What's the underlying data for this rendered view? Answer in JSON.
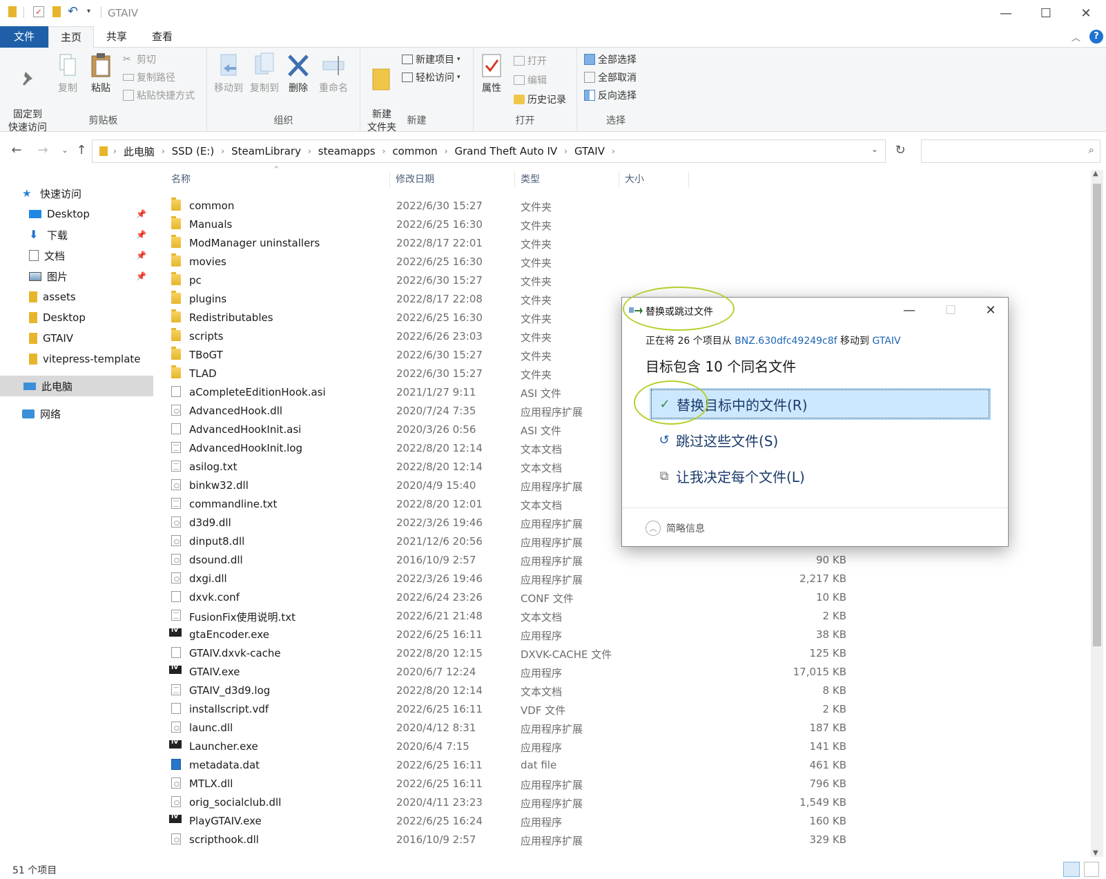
{
  "window": {
    "title": "GTAIV"
  },
  "ribbon_tabs": [
    "文件",
    "主页",
    "共享",
    "查看"
  ],
  "ribbon": {
    "clipboard": {
      "label": "剪贴板",
      "pin": "固定到\n快速访问",
      "copy": "复制",
      "paste": "粘贴",
      "cut": "剪切",
      "copy_path": "复制路径",
      "paste_shortcut": "粘贴快捷方式"
    },
    "organize": {
      "label": "组织",
      "move_to": "移动到",
      "copy_to": "复制到",
      "delete": "删除",
      "rename": "重命名"
    },
    "new": {
      "label": "新建",
      "new_folder": "新建\n文件夹",
      "new_item": "新建项目",
      "easy_access": "轻松访问"
    },
    "open": {
      "label": "打开",
      "properties": "属性",
      "open": "打开",
      "edit": "编辑",
      "history": "历史记录"
    },
    "select": {
      "label": "选择",
      "select_all": "全部选择",
      "select_none": "全部取消",
      "invert": "反向选择"
    }
  },
  "breadcrumb": [
    "此电脑",
    "SSD (E:)",
    "SteamLibrary",
    "steamapps",
    "common",
    "Grand Theft Auto IV",
    "GTAIV"
  ],
  "nav_pane": {
    "quick_access": "快速访问",
    "pinned": [
      "Desktop",
      "下载",
      "文档",
      "图片"
    ],
    "recent": [
      "assets",
      "Desktop",
      "GTAIV",
      "vitepress-template"
    ],
    "this_pc": "此电脑",
    "network": "网络"
  },
  "columns": {
    "name": "名称",
    "date": "修改日期",
    "type": "类型",
    "size": "大小"
  },
  "files": [
    {
      "name": "common",
      "date": "2022/6/30 15:27",
      "type": "文件夹",
      "size": "",
      "icon": "folder"
    },
    {
      "name": "Manuals",
      "date": "2022/6/25 16:30",
      "type": "文件夹",
      "size": "",
      "icon": "folder"
    },
    {
      "name": "ModManager uninstallers",
      "date": "2022/8/17 22:01",
      "type": "文件夹",
      "size": "",
      "icon": "folder"
    },
    {
      "name": "movies",
      "date": "2022/6/25 16:30",
      "type": "文件夹",
      "size": "",
      "icon": "folder"
    },
    {
      "name": "pc",
      "date": "2022/6/30 15:27",
      "type": "文件夹",
      "size": "",
      "icon": "folder"
    },
    {
      "name": "plugins",
      "date": "2022/8/17 22:08",
      "type": "文件夹",
      "size": "",
      "icon": "folder"
    },
    {
      "name": "Redistributables",
      "date": "2022/6/25 16:30",
      "type": "文件夹",
      "size": "",
      "icon": "folder"
    },
    {
      "name": "scripts",
      "date": "2022/6/26 23:03",
      "type": "文件夹",
      "size": "",
      "icon": "folder"
    },
    {
      "name": "TBoGT",
      "date": "2022/6/30 15:27",
      "type": "文件夹",
      "size": "",
      "icon": "folder"
    },
    {
      "name": "TLAD",
      "date": "2022/6/30 15:27",
      "type": "文件夹",
      "size": "",
      "icon": "folder"
    },
    {
      "name": "aCompleteEditionHook.asi",
      "date": "2021/1/27 9:11",
      "type": "ASI 文件",
      "size": "",
      "icon": "file"
    },
    {
      "name": "AdvancedHook.dll",
      "date": "2020/7/24 7:35",
      "type": "应用程序扩展",
      "size": "",
      "icon": "dllf"
    },
    {
      "name": "AdvancedHookInit.asi",
      "date": "2020/3/26 0:56",
      "type": "ASI 文件",
      "size": "",
      "icon": "file"
    },
    {
      "name": "AdvancedHookInit.log",
      "date": "2022/8/20 12:14",
      "type": "文本文档",
      "size": "",
      "icon": "txt"
    },
    {
      "name": "asilog.txt",
      "date": "2022/8/20 12:14",
      "type": "文本文档",
      "size": "",
      "icon": "txt"
    },
    {
      "name": "binkw32.dll",
      "date": "2020/4/9 15:40",
      "type": "应用程序扩展",
      "size": "",
      "icon": "dllf"
    },
    {
      "name": "commandline.txt",
      "date": "2022/8/20 12:01",
      "type": "文本文档",
      "size": "",
      "icon": "txt"
    },
    {
      "name": "d3d9.dll",
      "date": "2022/3/26 19:46",
      "type": "应用程序扩展",
      "size": "",
      "icon": "dllf"
    },
    {
      "name": "dinput8.dll",
      "date": "2021/12/6 20:56",
      "type": "应用程序扩展",
      "size": "",
      "icon": "dllf"
    },
    {
      "name": "dsound.dll",
      "date": "2016/10/9 2:57",
      "type": "应用程序扩展",
      "size": "90 KB",
      "icon": "dllf"
    },
    {
      "name": "dxgi.dll",
      "date": "2022/3/26 19:46",
      "type": "应用程序扩展",
      "size": "2,217 KB",
      "icon": "dllf"
    },
    {
      "name": "dxvk.conf",
      "date": "2022/6/24 23:26",
      "type": "CONF 文件",
      "size": "10 KB",
      "icon": "file"
    },
    {
      "name": "FusionFix使用说明.txt",
      "date": "2022/6/21 21:48",
      "type": "文本文档",
      "size": "2 KB",
      "icon": "txt"
    },
    {
      "name": "gtaEncoder.exe",
      "date": "2022/6/25 16:11",
      "type": "应用程序",
      "size": "38 KB",
      "icon": "exe"
    },
    {
      "name": "GTAIV.dxvk-cache",
      "date": "2022/8/20 12:15",
      "type": "DXVK-CACHE 文件",
      "size": "125 KB",
      "icon": "file"
    },
    {
      "name": "GTAIV.exe",
      "date": "2020/6/7 12:24",
      "type": "应用程序",
      "size": "17,015 KB",
      "icon": "exe"
    },
    {
      "name": "GTAIV_d3d9.log",
      "date": "2022/8/20 12:14",
      "type": "文本文档",
      "size": "8 KB",
      "icon": "txt"
    },
    {
      "name": "installscript.vdf",
      "date": "2022/6/25 16:11",
      "type": "VDF 文件",
      "size": "2 KB",
      "icon": "file"
    },
    {
      "name": "launc.dll",
      "date": "2020/4/12 8:31",
      "type": "应用程序扩展",
      "size": "187 KB",
      "icon": "dllf"
    },
    {
      "name": "Launcher.exe",
      "date": "2020/6/4 7:15",
      "type": "应用程序",
      "size": "141 KB",
      "icon": "exe"
    },
    {
      "name": "metadata.dat",
      "date": "2022/6/25 16:11",
      "type": "dat file",
      "size": "461 KB",
      "icon": "dat"
    },
    {
      "name": "MTLX.dll",
      "date": "2022/6/25 16:11",
      "type": "应用程序扩展",
      "size": "796 KB",
      "icon": "dllf"
    },
    {
      "name": "orig_socialclub.dll",
      "date": "2020/4/11 23:23",
      "type": "应用程序扩展",
      "size": "1,549 KB",
      "icon": "dllf"
    },
    {
      "name": "PlayGTAIV.exe",
      "date": "2022/6/25 16:24",
      "type": "应用程序",
      "size": "160 KB",
      "icon": "exe"
    },
    {
      "name": "scripthook.dll",
      "date": "2016/10/9 2:57",
      "type": "应用程序扩展",
      "size": "329 KB",
      "icon": "dllf"
    }
  ],
  "status": {
    "count": "51 个项目"
  },
  "dialog": {
    "title": "替换或跳过文件",
    "line1_prefix": "正在将 26 个项目从",
    "source": "BNZ.630dfc49249c8f",
    "line1_mid": "移动到",
    "dest": "GTAIV",
    "line2": "目标包含 10 个同名文件",
    "options": [
      "替换目标中的文件(R)",
      "跳过这些文件(S)",
      "让我决定每个文件(L)"
    ],
    "more_info": "简略信息"
  }
}
